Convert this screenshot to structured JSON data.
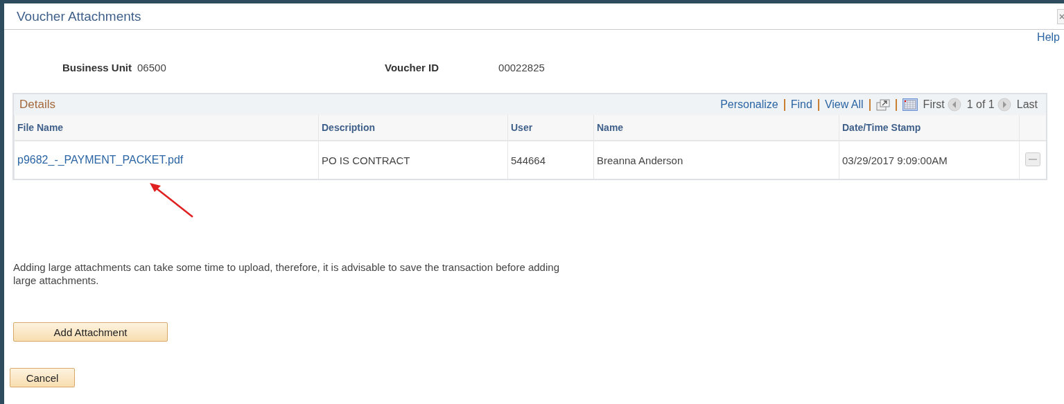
{
  "window": {
    "title": "Voucher Attachments"
  },
  "help_link": "Help",
  "fields": [
    {
      "label": "Business Unit",
      "value": "06500"
    },
    {
      "label": "Voucher ID",
      "value": "00022825"
    }
  ],
  "grid": {
    "title": "Details",
    "toolbar": {
      "links": [
        "Personalize",
        "Find",
        "View All"
      ],
      "first": "First",
      "count": "1 of 1",
      "last": "Last"
    },
    "columns": [
      "File Name",
      "Description",
      "User",
      "Name",
      "Date/Time Stamp"
    ],
    "rows": [
      {
        "file_name": "p9682_-_PAYMENT_PACKET.pdf",
        "description": "PO IS CONTRACT",
        "user": "544664",
        "name": "Breanna Anderson",
        "timestamp": "03/29/2017  9:09:00AM"
      }
    ]
  },
  "note": "Adding large attachments can take some time to upload, therefore, it is advisable to save the transaction before adding large attachments.",
  "buttons": {
    "add": "Add Attachment",
    "cancel": "Cancel"
  }
}
